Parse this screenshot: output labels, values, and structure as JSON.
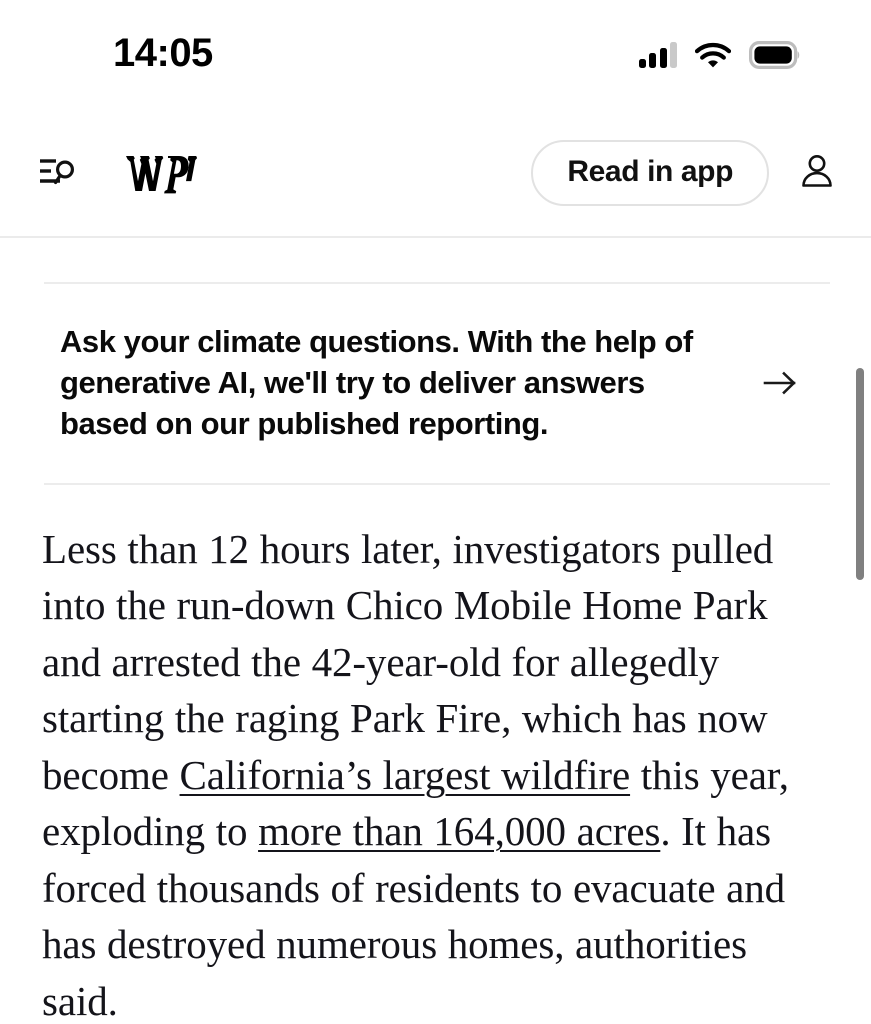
{
  "status_bar": {
    "time": "14:05",
    "cellular_icon": "signal-bars-icon",
    "cellular_bars_filled": 3,
    "cellular_bars_total": 4,
    "wifi_icon": "wifi-icon",
    "battery_icon": "battery-full-icon"
  },
  "masthead": {
    "menu_icon": "menu-search-icon",
    "logo": "wp-logo",
    "logo_text": "wp",
    "read_in_app_label": "Read in app",
    "account_icon": "account-person-icon"
  },
  "promo": {
    "text": "Ask your climate questions. With the help of generative AI, we'll try to deliver answers based on our published reporting.",
    "arrow_icon": "arrow-right-icon"
  },
  "article": {
    "paragraph_part_1": "Less than 12 hours later, investigators pulled into the run-down Chico Mobile Home Park and arrested the 42-year-old for allegedly starting the raging Park Fire, which has now become ",
    "link_1": "California’s largest wildfire",
    "paragraph_part_2": " this year, exploding to ",
    "link_2": "more than 164,000 acres",
    "paragraph_part_3": ". It has forced thousands of residents to evacuate and has destroyed numerous homes, authorities said."
  },
  "scrollbar": {
    "name": "vertical-scrollbar"
  },
  "colors": {
    "background": "#ffffff",
    "text": "#14141a",
    "divider": "#ececec",
    "scrollbar": "#808080",
    "signal_inactive": "#c9c9c9"
  }
}
